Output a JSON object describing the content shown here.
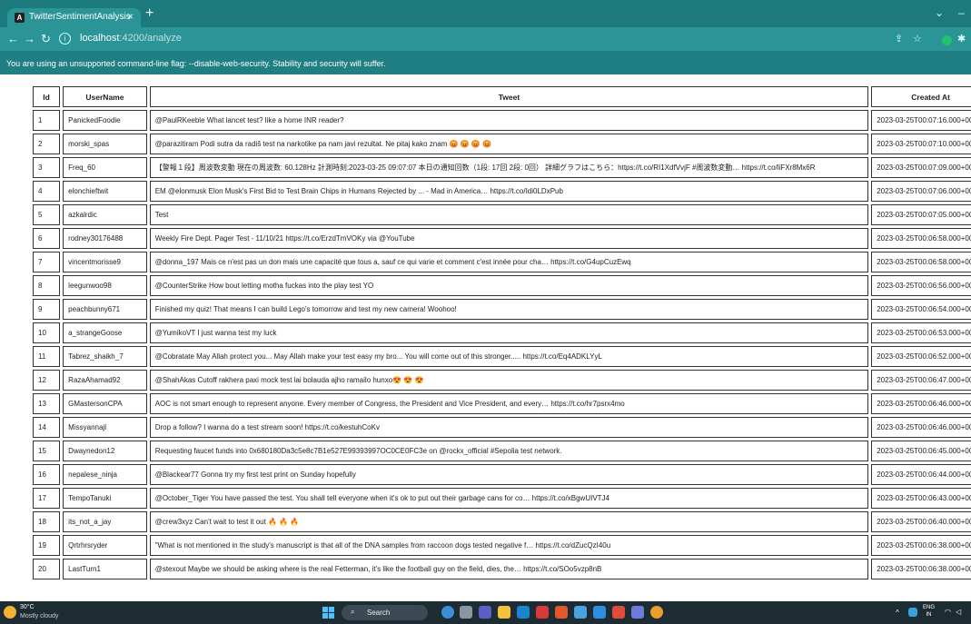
{
  "browser": {
    "tab_title": "TwitterSentimentAnalysis",
    "tab_close": "×",
    "new_tab": "+",
    "url_host": "localhost",
    "url_path": ":4200/analyze",
    "info_banner": "You are using an unsupported command-line flag: --disable-web-security. Stability and security will suffer."
  },
  "table": {
    "headers": [
      "Id",
      "UserName",
      "Tweet",
      "Created At"
    ],
    "rows": [
      [
        "1",
        "PanickedFoodie",
        "@PaulRKeeble What lancet test? like a home INR reader?",
        "2023-03-25T00:07:16.000+00:00"
      ],
      [
        "2",
        "morski_spas",
        "@parazitiram Podi sutra da radiš test na narkotike pa nam javi rezultat. Ne pitaj kako znam 😡 😡 😡 😡",
        "2023-03-25T00:07:10.000+00:00"
      ],
      [
        "3",
        "Freq_60",
        "【警報１段】周波数変動 現在の周波数: 60.128Hz 計測時刻:2023-03-25 09:07:07 本日の通知回数（1段: 17回 2段: 0回） 詳細グラフはこちら：https://t.co/RI1XdfVvjF #周波数変動… https://t.co/liFXr8Mx6R",
        "2023-03-25T00:07:09.000+00:00"
      ],
      [
        "4",
        "elonchieftwit",
        "EM @elonmusk Elon Musk's First Bid to Test Brain Chips in Humans Rejected by ... - Mad in America… https://t.co/Idi0LDxPub",
        "2023-03-25T00:07:06.000+00:00"
      ],
      [
        "5",
        "azkalrdic",
        "Test",
        "2023-03-25T00:07:05.000+00:00"
      ],
      [
        "6",
        "rodney30176488",
        "Weekly Fire Dept. Pager Test - 11/10/21 https://t.co/ErzdTmVOKy via @YouTube",
        "2023-03-25T00:06:58.000+00:00"
      ],
      [
        "7",
        "vincentmorisse9",
        "@donna_197 Mais ce n'est pas un don mais une capacité que tous a, sauf ce qui varie et comment c'est innée pour cha… https://t.co/G4upCuzEwq",
        "2023-03-25T00:06:58.000+00:00"
      ],
      [
        "8",
        "leegunwoo98",
        "@CounterStrike How bout letting motha fuckas into the play test YO",
        "2023-03-25T00:06:56.000+00:00"
      ],
      [
        "9",
        "peachbunny671",
        "Finished my quiz! That means I can build Lego's tomorrow and test my new camera! Woohoo!",
        "2023-03-25T00:06:54.000+00:00"
      ],
      [
        "10",
        "a_strangeGoose",
        "@YumikoVT I just wanna test my luck",
        "2023-03-25T00:06:53.000+00:00"
      ],
      [
        "11",
        "Tabrez_shaikh_7",
        "@Cobratate May Allah protect you... May Allah make your test easy my bro... You will come out of this stronger..... https://t.co/Eq4ADKLYyL",
        "2023-03-25T00:06:52.000+00:00"
      ],
      [
        "12",
        "RazaAhamad92",
        "@ShahAkas Cutoff rakhera paxi mock test lai bolauda ajho ramailo hunxo😍 😍 😍",
        "2023-03-25T00:06:47.000+00:00"
      ],
      [
        "13",
        "GMastersonCPA",
        "AOC is not smart enough to represent anyone. Every member of Congress, the President and Vice President, and every… https://t.co/hr7psrx4mo",
        "2023-03-25T00:06:46.000+00:00"
      ],
      [
        "14",
        "Missyannajl",
        "Drop a follow? I wanna do a test stream soon! https://t.co/kestuhCoKv",
        "2023-03-25T00:06:46.000+00:00"
      ],
      [
        "15",
        "Dwaynedon12",
        "Requesting faucet funds into 0x680180Da3c5e8c7B1e527E99393997OC0CE0FC3e on @rockx_official #Sepolia test network.",
        "2023-03-25T00:06:45.000+00:00"
      ],
      [
        "16",
        "nepalese_ninja",
        "@Blackear77 Gonna try my first test print on Sunday hopefully",
        "2023-03-25T00:06:44.000+00:00"
      ],
      [
        "17",
        "TempoTanuki",
        "@October_Tiger You have passed the test. You shall tell everyone when it's ok to put out their garbage cans for co… https://t.co/xBgwUIVTJ4",
        "2023-03-25T00:06:43.000+00:00"
      ],
      [
        "18",
        "its_not_a_jay",
        "@crew3xyz Can't wait to test it out 🔥 🔥 🔥",
        "2023-03-25T00:06:40.000+00:00"
      ],
      [
        "19",
        "Qrtrhrsryder",
        "\"What is not mentioned in the study's manuscript is that all of the DNA samples from raccoon dogs tested negative f… https://t.co/dZucQzI40u",
        "2023-03-25T00:06:38.000+00:00"
      ],
      [
        "20",
        "LastTurn1",
        "@stexout Maybe we should be asking where is the real Fetterman, it's like the football guy on the field, dies, the… https://t.co/SOo5vzp8nB",
        "2023-03-25T00:06:38.000+00:00"
      ]
    ]
  },
  "taskbar": {
    "temp": "30°C",
    "weather": "Mostly cloudy",
    "search": "Search",
    "lang": "ENG",
    "region": "IN"
  }
}
